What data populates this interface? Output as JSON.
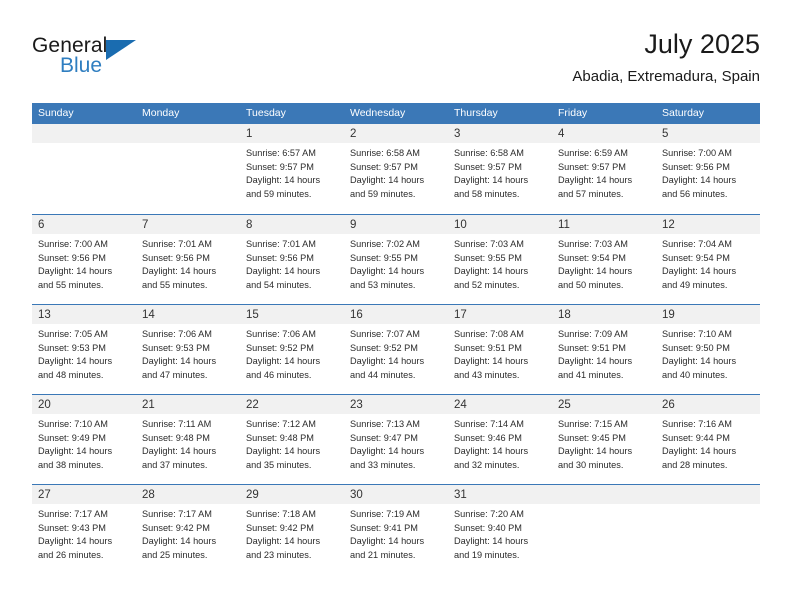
{
  "brand": {
    "name_part1": "General",
    "name_part2": "Blue",
    "flag_icon": "blue-triangle-flag",
    "accent_color": "#1a6cb0"
  },
  "header": {
    "title": "July 2025",
    "subtitle": "Abadia, Extremadura, Spain"
  },
  "calendar": {
    "header_bg_color": "#3b78b7",
    "daynum_bg_color": "#f1f1f1",
    "weekdays": [
      "Sunday",
      "Monday",
      "Tuesday",
      "Wednesday",
      "Thursday",
      "Friday",
      "Saturday"
    ],
    "weeks": [
      [
        {
          "day": "",
          "sunrise": "",
          "sunset": "",
          "daylight_line1": "",
          "daylight_line2": ""
        },
        {
          "day": "",
          "sunrise": "",
          "sunset": "",
          "daylight_line1": "",
          "daylight_line2": ""
        },
        {
          "day": "1",
          "sunrise": "Sunrise: 6:57 AM",
          "sunset": "Sunset: 9:57 PM",
          "daylight_line1": "Daylight: 14 hours",
          "daylight_line2": "and 59 minutes."
        },
        {
          "day": "2",
          "sunrise": "Sunrise: 6:58 AM",
          "sunset": "Sunset: 9:57 PM",
          "daylight_line1": "Daylight: 14 hours",
          "daylight_line2": "and 59 minutes."
        },
        {
          "day": "3",
          "sunrise": "Sunrise: 6:58 AM",
          "sunset": "Sunset: 9:57 PM",
          "daylight_line1": "Daylight: 14 hours",
          "daylight_line2": "and 58 minutes."
        },
        {
          "day": "4",
          "sunrise": "Sunrise: 6:59 AM",
          "sunset": "Sunset: 9:57 PM",
          "daylight_line1": "Daylight: 14 hours",
          "daylight_line2": "and 57 minutes."
        },
        {
          "day": "5",
          "sunrise": "Sunrise: 7:00 AM",
          "sunset": "Sunset: 9:56 PM",
          "daylight_line1": "Daylight: 14 hours",
          "daylight_line2": "and 56 minutes."
        }
      ],
      [
        {
          "day": "6",
          "sunrise": "Sunrise: 7:00 AM",
          "sunset": "Sunset: 9:56 PM",
          "daylight_line1": "Daylight: 14 hours",
          "daylight_line2": "and 55 minutes."
        },
        {
          "day": "7",
          "sunrise": "Sunrise: 7:01 AM",
          "sunset": "Sunset: 9:56 PM",
          "daylight_line1": "Daylight: 14 hours",
          "daylight_line2": "and 55 minutes."
        },
        {
          "day": "8",
          "sunrise": "Sunrise: 7:01 AM",
          "sunset": "Sunset: 9:56 PM",
          "daylight_line1": "Daylight: 14 hours",
          "daylight_line2": "and 54 minutes."
        },
        {
          "day": "9",
          "sunrise": "Sunrise: 7:02 AM",
          "sunset": "Sunset: 9:55 PM",
          "daylight_line1": "Daylight: 14 hours",
          "daylight_line2": "and 53 minutes."
        },
        {
          "day": "10",
          "sunrise": "Sunrise: 7:03 AM",
          "sunset": "Sunset: 9:55 PM",
          "daylight_line1": "Daylight: 14 hours",
          "daylight_line2": "and 52 minutes."
        },
        {
          "day": "11",
          "sunrise": "Sunrise: 7:03 AM",
          "sunset": "Sunset: 9:54 PM",
          "daylight_line1": "Daylight: 14 hours",
          "daylight_line2": "and 50 minutes."
        },
        {
          "day": "12",
          "sunrise": "Sunrise: 7:04 AM",
          "sunset": "Sunset: 9:54 PM",
          "daylight_line1": "Daylight: 14 hours",
          "daylight_line2": "and 49 minutes."
        }
      ],
      [
        {
          "day": "13",
          "sunrise": "Sunrise: 7:05 AM",
          "sunset": "Sunset: 9:53 PM",
          "daylight_line1": "Daylight: 14 hours",
          "daylight_line2": "and 48 minutes."
        },
        {
          "day": "14",
          "sunrise": "Sunrise: 7:06 AM",
          "sunset": "Sunset: 9:53 PM",
          "daylight_line1": "Daylight: 14 hours",
          "daylight_line2": "and 47 minutes."
        },
        {
          "day": "15",
          "sunrise": "Sunrise: 7:06 AM",
          "sunset": "Sunset: 9:52 PM",
          "daylight_line1": "Daylight: 14 hours",
          "daylight_line2": "and 46 minutes."
        },
        {
          "day": "16",
          "sunrise": "Sunrise: 7:07 AM",
          "sunset": "Sunset: 9:52 PM",
          "daylight_line1": "Daylight: 14 hours",
          "daylight_line2": "and 44 minutes."
        },
        {
          "day": "17",
          "sunrise": "Sunrise: 7:08 AM",
          "sunset": "Sunset: 9:51 PM",
          "daylight_line1": "Daylight: 14 hours",
          "daylight_line2": "and 43 minutes."
        },
        {
          "day": "18",
          "sunrise": "Sunrise: 7:09 AM",
          "sunset": "Sunset: 9:51 PM",
          "daylight_line1": "Daylight: 14 hours",
          "daylight_line2": "and 41 minutes."
        },
        {
          "day": "19",
          "sunrise": "Sunrise: 7:10 AM",
          "sunset": "Sunset: 9:50 PM",
          "daylight_line1": "Daylight: 14 hours",
          "daylight_line2": "and 40 minutes."
        }
      ],
      [
        {
          "day": "20",
          "sunrise": "Sunrise: 7:10 AM",
          "sunset": "Sunset: 9:49 PM",
          "daylight_line1": "Daylight: 14 hours",
          "daylight_line2": "and 38 minutes."
        },
        {
          "day": "21",
          "sunrise": "Sunrise: 7:11 AM",
          "sunset": "Sunset: 9:48 PM",
          "daylight_line1": "Daylight: 14 hours",
          "daylight_line2": "and 37 minutes."
        },
        {
          "day": "22",
          "sunrise": "Sunrise: 7:12 AM",
          "sunset": "Sunset: 9:48 PM",
          "daylight_line1": "Daylight: 14 hours",
          "daylight_line2": "and 35 minutes."
        },
        {
          "day": "23",
          "sunrise": "Sunrise: 7:13 AM",
          "sunset": "Sunset: 9:47 PM",
          "daylight_line1": "Daylight: 14 hours",
          "daylight_line2": "and 33 minutes."
        },
        {
          "day": "24",
          "sunrise": "Sunrise: 7:14 AM",
          "sunset": "Sunset: 9:46 PM",
          "daylight_line1": "Daylight: 14 hours",
          "daylight_line2": "and 32 minutes."
        },
        {
          "day": "25",
          "sunrise": "Sunrise: 7:15 AM",
          "sunset": "Sunset: 9:45 PM",
          "daylight_line1": "Daylight: 14 hours",
          "daylight_line2": "and 30 minutes."
        },
        {
          "day": "26",
          "sunrise": "Sunrise: 7:16 AM",
          "sunset": "Sunset: 9:44 PM",
          "daylight_line1": "Daylight: 14 hours",
          "daylight_line2": "and 28 minutes."
        }
      ],
      [
        {
          "day": "27",
          "sunrise": "Sunrise: 7:17 AM",
          "sunset": "Sunset: 9:43 PM",
          "daylight_line1": "Daylight: 14 hours",
          "daylight_line2": "and 26 minutes."
        },
        {
          "day": "28",
          "sunrise": "Sunrise: 7:17 AM",
          "sunset": "Sunset: 9:42 PM",
          "daylight_line1": "Daylight: 14 hours",
          "daylight_line2": "and 25 minutes."
        },
        {
          "day": "29",
          "sunrise": "Sunrise: 7:18 AM",
          "sunset": "Sunset: 9:42 PM",
          "daylight_line1": "Daylight: 14 hours",
          "daylight_line2": "and 23 minutes."
        },
        {
          "day": "30",
          "sunrise": "Sunrise: 7:19 AM",
          "sunset": "Sunset: 9:41 PM",
          "daylight_line1": "Daylight: 14 hours",
          "daylight_line2": "and 21 minutes."
        },
        {
          "day": "31",
          "sunrise": "Sunrise: 7:20 AM",
          "sunset": "Sunset: 9:40 PM",
          "daylight_line1": "Daylight: 14 hours",
          "daylight_line2": "and 19 minutes."
        },
        {
          "day": "",
          "sunrise": "",
          "sunset": "",
          "daylight_line1": "",
          "daylight_line2": ""
        },
        {
          "day": "",
          "sunrise": "",
          "sunset": "",
          "daylight_line1": "",
          "daylight_line2": ""
        }
      ]
    ]
  }
}
